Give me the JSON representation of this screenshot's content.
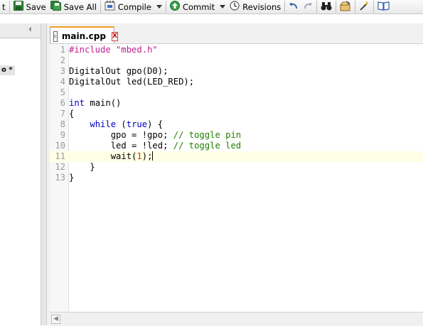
{
  "toolbar": {
    "partial_label": "t",
    "save_label": "Save",
    "save_all_label": "Save All",
    "compile_label": "Compile",
    "commit_label": "Commit",
    "revisions_label": "Revisions"
  },
  "sidebar": {
    "collapse_glyph": "‹",
    "tree_item_text": "o *"
  },
  "editor": {
    "tab": {
      "label": "main.cpp",
      "close_glyph": "X",
      "file_glyph": "c"
    },
    "active_line": 11,
    "lines": [
      {
        "num": "1",
        "text": "#include \"mbed.h\""
      },
      {
        "num": "2",
        "text": ""
      },
      {
        "num": "3",
        "text": "DigitalOut gpo(D0);"
      },
      {
        "num": "4",
        "text": "DigitalOut led(LED_RED);"
      },
      {
        "num": "5",
        "text": ""
      },
      {
        "num": "6",
        "text": "int main()"
      },
      {
        "num": "7",
        "text": "{"
      },
      {
        "num": "8",
        "text": "    while (true) {"
      },
      {
        "num": "9",
        "text": "        gpo = !gpo; // toggle pin"
      },
      {
        "num": "10",
        "text": "        led = !led; // toggle led"
      },
      {
        "num": "11",
        "text": "        wait(1);"
      },
      {
        "num": "12",
        "text": "    }"
      },
      {
        "num": "13",
        "text": "}"
      }
    ]
  },
  "colors": {
    "keyword": "#0000c0",
    "string": "#c02090",
    "comment": "#208000",
    "number": "#c04000",
    "active_line": "#ffffe6",
    "tab_accent": "#f0a020"
  }
}
